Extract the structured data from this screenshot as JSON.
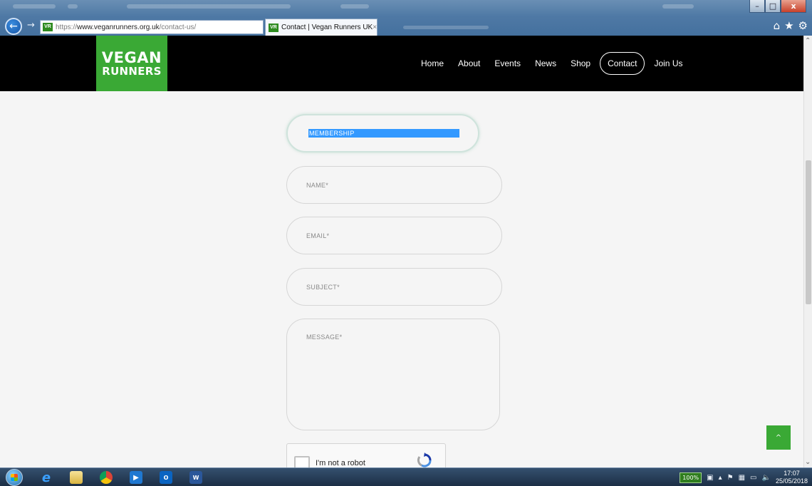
{
  "browser": {
    "address": {
      "favicon": "VR",
      "protocol": "https://",
      "host": "www.veganrunners.org.uk",
      "path": "/contact-us/"
    },
    "search_icon": "search-icon",
    "refresh_icon": "refresh-icon",
    "tab": {
      "favicon": "VR",
      "title": "Contact | Vegan Runners UK",
      "close": "×"
    },
    "window_controls": {
      "minimize": "–",
      "maximize": "□",
      "close": "x"
    },
    "toolbar_icons": [
      "home-icon",
      "favorites-star-icon",
      "settings-gear-icon"
    ]
  },
  "site": {
    "logo": {
      "line1": "VEGAN",
      "line2": "RUNNERS",
      "color": "#3aa935"
    },
    "nav": [
      {
        "label": "Home"
      },
      {
        "label": "About"
      },
      {
        "label": "Events"
      },
      {
        "label": "News"
      },
      {
        "label": "Shop"
      },
      {
        "label": "Contact",
        "active": true
      },
      {
        "label": "Join Us"
      }
    ]
  },
  "form": {
    "topic_select": {
      "selected": "MEMBERSHIP"
    },
    "name": {
      "placeholder": "NAME*"
    },
    "email": {
      "placeholder": "EMAIL*"
    },
    "subject": {
      "placeholder": "SUBJECT*"
    },
    "message": {
      "placeholder": "MESSAGE*"
    },
    "recaptcha": {
      "label": "I'm not a robot"
    }
  },
  "back_to_top": {
    "glyph": "^"
  },
  "taskbar": {
    "apps": [
      "windows-start",
      "internet-explorer",
      "file-explorer",
      "chrome",
      "media-player",
      "outlook",
      "word"
    ],
    "tray": {
      "zoom": "100%",
      "time": "17:07",
      "date": "25/05/2018"
    }
  }
}
